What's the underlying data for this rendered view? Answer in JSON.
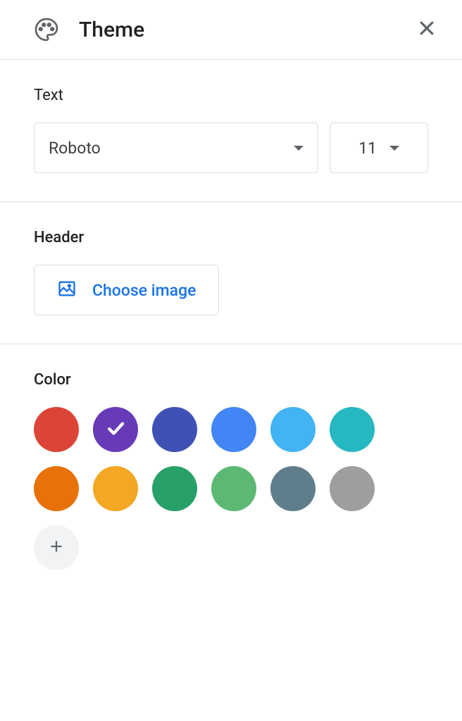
{
  "header": {
    "title": "Theme"
  },
  "text": {
    "label": "Text",
    "font": "Roboto",
    "size": "11"
  },
  "header_section": {
    "label": "Header",
    "button": "Choose image"
  },
  "color": {
    "label": "Color",
    "swatches": [
      {
        "hex": "#db4437",
        "selected": false
      },
      {
        "hex": "#673ab7",
        "selected": true
      },
      {
        "hex": "#3f51b5",
        "selected": false
      },
      {
        "hex": "#4285f4",
        "selected": false
      },
      {
        "hex": "#42b3f4",
        "selected": false
      },
      {
        "hex": "#26b8c0",
        "selected": false
      },
      {
        "hex": "#e8710a",
        "selected": false
      },
      {
        "hex": "#f4a724",
        "selected": false
      },
      {
        "hex": "#28a169",
        "selected": false
      },
      {
        "hex": "#5bb974",
        "selected": false
      },
      {
        "hex": "#607d8b",
        "selected": false
      },
      {
        "hex": "#9e9e9e",
        "selected": false
      }
    ]
  }
}
